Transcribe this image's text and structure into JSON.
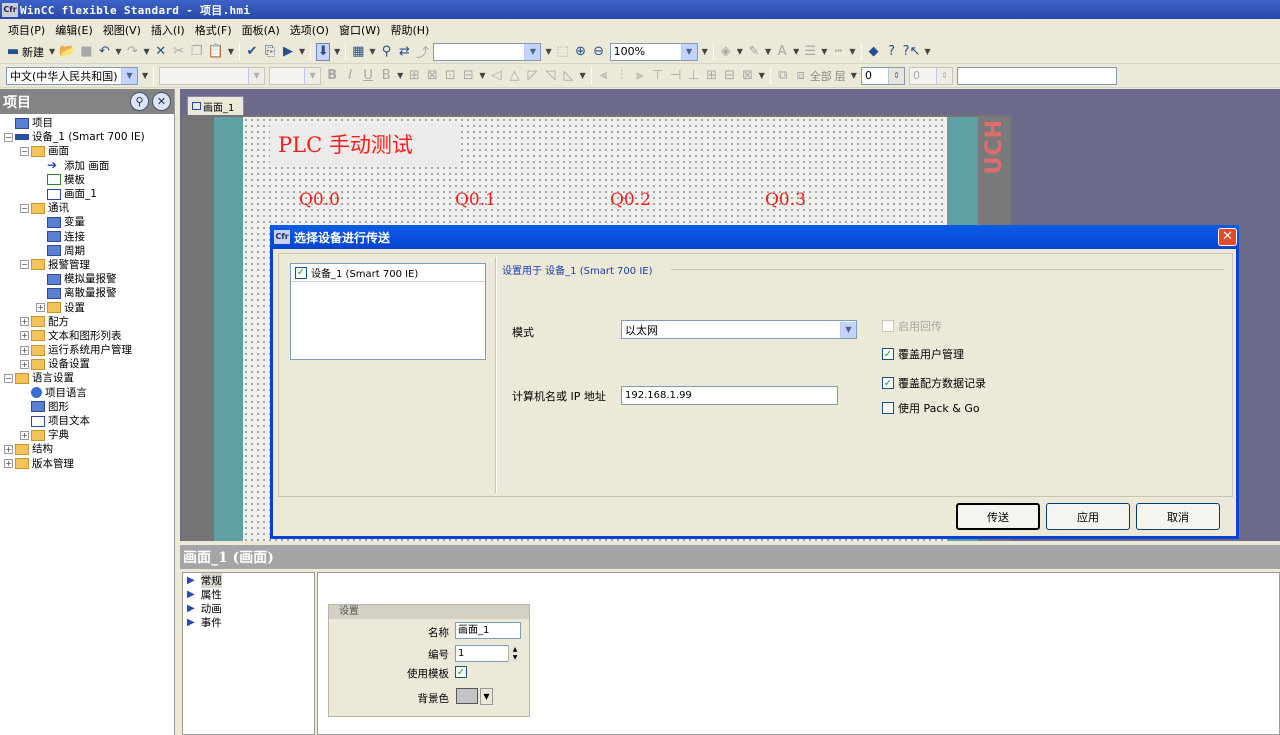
{
  "titlebar": {
    "icon": "Cfr",
    "title": "WinCC flexible Standard - 项目.hmi"
  },
  "menu": [
    "项目(P)",
    "编辑(E)",
    "视图(V)",
    "插入(I)",
    "格式(F)",
    "面板(A)",
    "选项(O)",
    "窗口(W)",
    "帮助(H)"
  ],
  "toolbar1": {
    "new_label": "新建",
    "zoom_value": "100%",
    "font_combo": ""
  },
  "toolbar2": {
    "language": "中文(中华人民共和国)",
    "all_label": "全部",
    "layer_label": "层",
    "layer_value": "0",
    "layer_value2": "0"
  },
  "project_pane": {
    "header": "项目",
    "nodes": [
      {
        "label": "项目",
        "level": 0,
        "icon": "blue",
        "exp": ""
      },
      {
        "label": "设备_1 (Smart 700 IE)",
        "level": 0,
        "icon": "dev",
        "exp": "−"
      },
      {
        "label": "画面",
        "level": 1,
        "icon": "folder",
        "exp": "−"
      },
      {
        "label": "添加 画面",
        "level": 2,
        "icon": "arrow",
        "exp": ""
      },
      {
        "label": "模板",
        "level": 2,
        "icon": "green",
        "exp": ""
      },
      {
        "label": "画面_1",
        "level": 2,
        "icon": "screen",
        "exp": ""
      },
      {
        "label": "通讯",
        "level": 1,
        "icon": "folder",
        "exp": "−"
      },
      {
        "label": "变量",
        "level": 2,
        "icon": "blue",
        "exp": ""
      },
      {
        "label": "连接",
        "level": 2,
        "icon": "blue",
        "exp": ""
      },
      {
        "label": "周期",
        "level": 2,
        "icon": "blue",
        "exp": ""
      },
      {
        "label": "报警管理",
        "level": 1,
        "icon": "folder",
        "exp": "−"
      },
      {
        "label": "模拟量报警",
        "level": 2,
        "icon": "blue",
        "exp": ""
      },
      {
        "label": "离散量报警",
        "level": 2,
        "icon": "blue",
        "exp": ""
      },
      {
        "label": "设置",
        "level": 2,
        "icon": "folder",
        "exp": "+"
      },
      {
        "label": "配方",
        "level": 1,
        "icon": "folder",
        "exp": "+"
      },
      {
        "label": "文本和图形列表",
        "level": 1,
        "icon": "folder",
        "exp": "+"
      },
      {
        "label": "运行系统用户管理",
        "level": 1,
        "icon": "folder",
        "exp": "+"
      },
      {
        "label": "设备设置",
        "level": 1,
        "icon": "folder",
        "exp": "+"
      },
      {
        "label": "语言设置",
        "level": 0,
        "icon": "folder",
        "exp": "−"
      },
      {
        "label": "项目语言",
        "level": 1,
        "icon": "globe",
        "exp": ""
      },
      {
        "label": "图形",
        "level": 1,
        "icon": "blue",
        "exp": ""
      },
      {
        "label": "项目文本",
        "level": 1,
        "icon": "screen",
        "exp": ""
      },
      {
        "label": "字典",
        "level": 1,
        "icon": "folder",
        "exp": "+"
      },
      {
        "label": "结构",
        "level": 0,
        "icon": "folder",
        "exp": "+"
      },
      {
        "label": "版本管理",
        "level": 0,
        "icon": "folder",
        "exp": "+"
      }
    ]
  },
  "workarea": {
    "tab_label": "画面_1",
    "screen_title": "PLC 手动测试",
    "outputs": [
      "Q0.0",
      "Q0.1",
      "Q0.2",
      "Q0.3"
    ],
    "side_text": "UCH"
  },
  "dialog": {
    "icon": "Cfr",
    "title": "选择设备进行传送",
    "device_item": "设备_1 (Smart 700 IE)",
    "settings_header": "设置用于 设备_1 (Smart 700 IE)",
    "mode_label": "模式",
    "mode_value": "以太网",
    "ip_label": "计算机名或 IP 地址",
    "ip_value": "192.168.1.99",
    "options": [
      {
        "label": "启用回传",
        "checked": false,
        "enabled": false
      },
      {
        "label": "覆盖用户管理",
        "checked": true,
        "enabled": true
      },
      {
        "label": "覆盖配方数据记录",
        "checked": true,
        "enabled": true
      },
      {
        "label": "使用 Pack & Go",
        "checked": false,
        "enabled": true
      }
    ],
    "buttons": {
      "transfer": "传送",
      "apply": "应用",
      "cancel": "取消"
    }
  },
  "properties": {
    "header": "画面_1 (画面)",
    "nav": [
      "常规",
      "属性",
      "动画",
      "事件"
    ],
    "settings_title": "设置",
    "name_label": "名称",
    "name_value": "画面_1",
    "number_label": "编号",
    "number_value": "1",
    "template_label": "使用模板",
    "bgcolor_label": "背景色"
  },
  "colors": {
    "titlebar": "#2a4aa8",
    "dialog_border": "#0843d6",
    "plc_text": "#ff1a1a",
    "teal": "#5fa0a4"
  }
}
